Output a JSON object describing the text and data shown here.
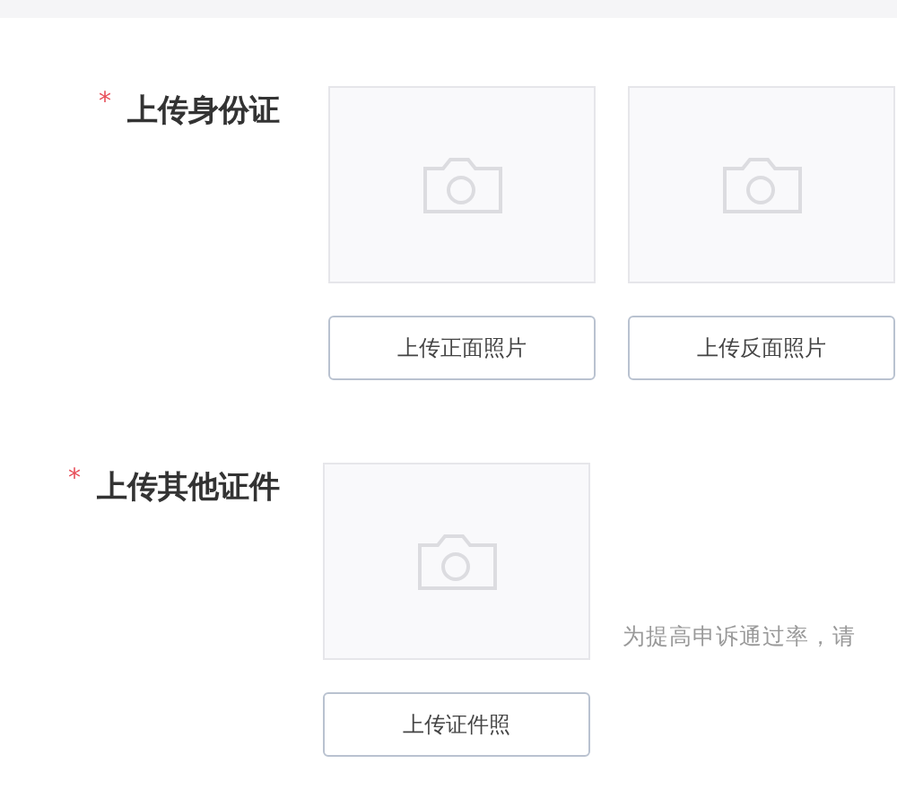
{
  "sections": [
    {
      "label": "上传身份证",
      "required_mark": "*",
      "uploads": [
        {
          "button": "上传正面照片"
        },
        {
          "button": "上传反面照片"
        }
      ]
    },
    {
      "label": "上传其他证件",
      "required_mark": "*",
      "uploads": [
        {
          "button": "上传证件照"
        }
      ],
      "hint": "为提高申诉通过率，请"
    }
  ]
}
